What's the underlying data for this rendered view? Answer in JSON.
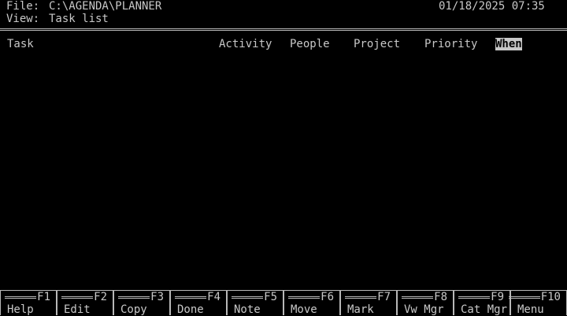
{
  "header": {
    "file_label": "File:",
    "file_path": "C:\\AGENDA\\PLANNER",
    "datetime": "01/18/2025 07:35",
    "view_label": "View:",
    "view_name": "Task list"
  },
  "columns": {
    "task": "Task",
    "activity": "Activity",
    "people": "People",
    "project": "Project",
    "priority": "Priority",
    "when": "When",
    "selected": "when"
  },
  "function_keys": [
    {
      "key": "F1",
      "label": "Help"
    },
    {
      "key": "F2",
      "label": "Edit"
    },
    {
      "key": "F3",
      "label": "Copy"
    },
    {
      "key": "F4",
      "label": "Done"
    },
    {
      "key": "F5",
      "label": "Note"
    },
    {
      "key": "F6",
      "label": "Move"
    },
    {
      "key": "F7",
      "label": "Mark"
    },
    {
      "key": "F8",
      "label": "Vw Mgr"
    },
    {
      "key": "F9",
      "label": "Cat Mgr"
    },
    {
      "key": "F10",
      "label": "Menu"
    }
  ],
  "colors": {
    "background": "#000000",
    "text": "#c8c8c8",
    "highlight_bg": "#c8c8c8",
    "highlight_text": "#000000"
  }
}
